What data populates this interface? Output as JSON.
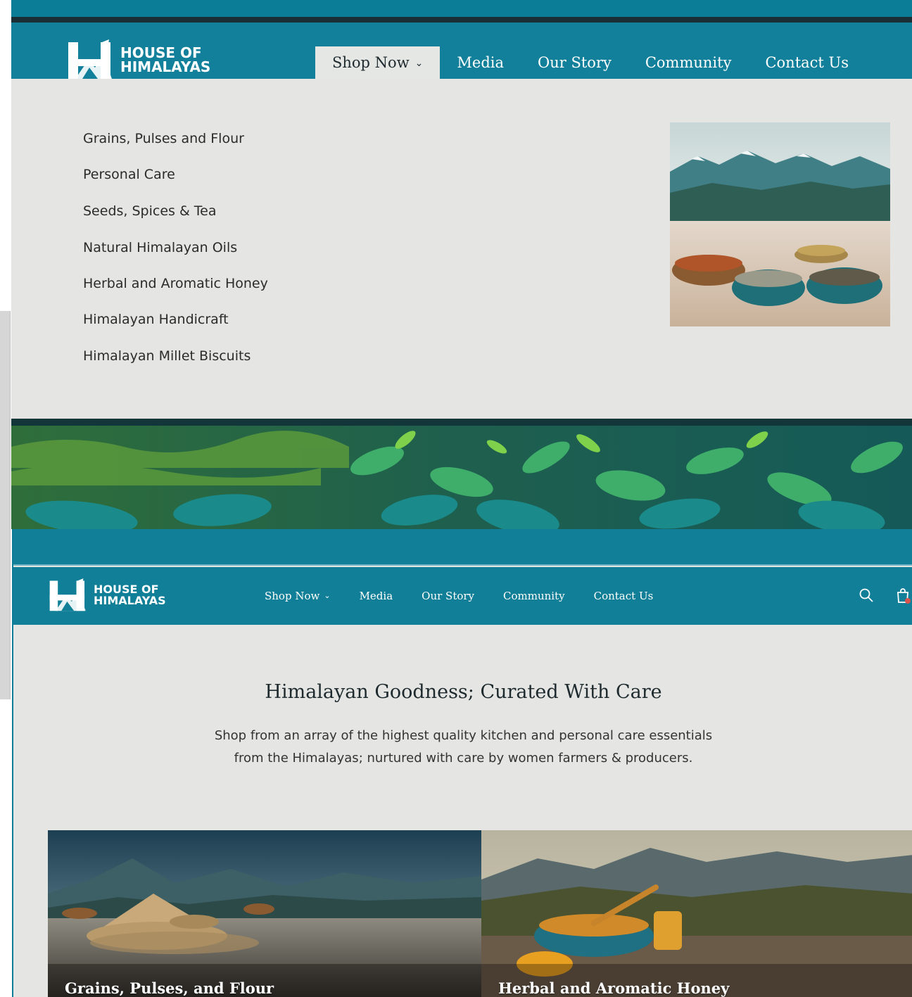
{
  "brand": {
    "line1": "HOUSE OF",
    "line2": "HIMALAYAS"
  },
  "nav": {
    "items": [
      "Shop Now",
      "Media",
      "Our Story",
      "Community",
      "Contact Us"
    ],
    "active": "Shop Now"
  },
  "dropdown": {
    "categories": [
      "Grains, Pulses and Flour",
      "Personal Care",
      "Seeds, Spices & Tea",
      "Natural Himalayan Oils",
      "Herbal and Aromatic Honey",
      "Himalayan Handicraft",
      "Himalayan Millet Biscuits"
    ]
  },
  "header_icons": {
    "search": "search-icon",
    "cart": "cart-icon"
  },
  "hero": {
    "headline": "Himalayan Goodness; Curated With Care",
    "subtext_line1": "Shop from an array of the highest quality kitchen and personal care essentials",
    "subtext_line2": "from the Himalayas; nurtured with care by women farmers & producers."
  },
  "cards": [
    {
      "label": "Grains, Pulses, and Flour"
    },
    {
      "label": "Herbal and Aromatic Honey"
    }
  ],
  "colors": {
    "teal": "#12809b",
    "panel": "#e5e6e4"
  }
}
